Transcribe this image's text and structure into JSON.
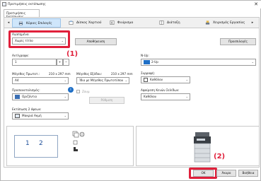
{
  "window": {
    "title": "Προτιμήσεις εκτύπωσης",
    "close_glyph": "✕"
  },
  "pref_tab": "Προτιμήσεις Εκτύπωσης",
  "tabs": [
    {
      "label": "Κύριες Επιλογές",
      "icon": "printer-icon",
      "active": true
    },
    {
      "label": "Δίσκος Χαρτιού",
      "icon": "paper-tray-icon",
      "active": false
    },
    {
      "label": "Φινίρισμα",
      "icon": "finishing-icon",
      "active": false
    },
    {
      "label": "Διάταξη",
      "icon": "layout-icon",
      "active": false
    },
    {
      "label": "Χειρισμός Εργασίας",
      "icon": "job-handling-icon",
      "active": false
    }
  ],
  "tab_nav": {
    "left": "◂",
    "right": "▸"
  },
  "favorites": {
    "label": "Αγαπημένα:",
    "value": "Χωρίς τίτλο"
  },
  "buttons": {
    "save": "Αποθήκευση",
    "defaults": "Προεπιλογές",
    "rotate": "Ρύθμιση",
    "ok": "OK",
    "cancel": "Άκυρο",
    "help": "Βοήθεια"
  },
  "copies": {
    "label": "Αντίγραφα:",
    "value": "1"
  },
  "paper_size": {
    "label": "Μέγεθος Πρωτοτ.:",
    "dims": "210 x 297 mm",
    "value": "A4"
  },
  "output_size": {
    "label": "Μέγεθος Εξόδου:",
    "dims": "210 x 297 mm",
    "value": "Ίδιο με Μέγεθος Πρωτοτύπου"
  },
  "orientation": {
    "label": "Προσανατολισμός:",
    "value": "Οριζόντιο"
  },
  "zoom": {
    "label": "Ζουμ"
  },
  "duplex": {
    "label": "Εκτύπωση 2 όψεων:",
    "value": "Μακριά Ακμή"
  },
  "nup": {
    "label": "N-Up:",
    "value": "2-Up"
  },
  "staple": {
    "label": "Συρραφή:",
    "value": "Καθόλου"
  },
  "color_mode": {
    "label": "Αφαίρεση Κενών Σελίδων:",
    "value": "Καθόλου"
  },
  "preview_pages": [
    "1",
    "2"
  ],
  "annotations": {
    "one": "(1)",
    "two": "(2)"
  },
  "colors": {
    "accent": "#cfe6fb",
    "annotation_red": "#e0203b",
    "nup_icon_blue": "#1f6fc6"
  }
}
